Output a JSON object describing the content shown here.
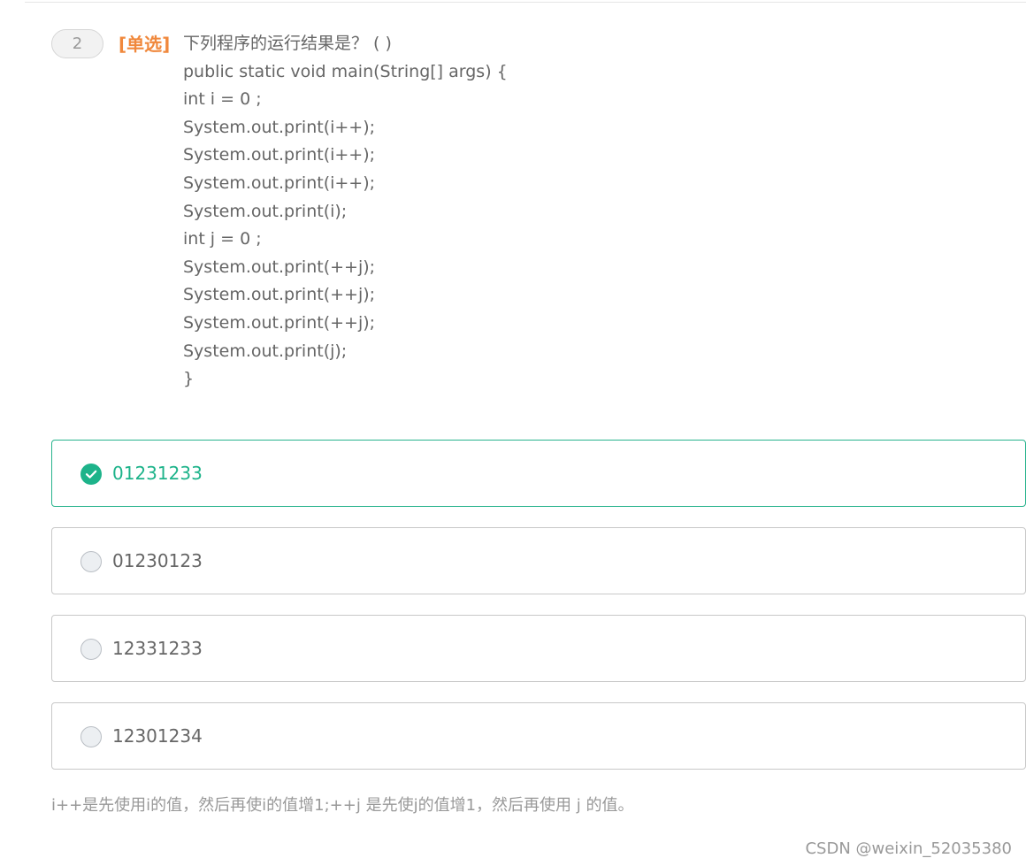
{
  "question": {
    "number": "2",
    "type_label": "[单选]",
    "lines": [
      "下列程序的运行结果是？ ( )",
      "public static void main(String[] args) {",
      "int i = 0 ;",
      "System.out.print(i++);",
      "System.out.print(i++);",
      "System.out.print(i++);",
      "System.out.print(i);",
      "int j = 0 ;",
      "System.out.print(++j);",
      "System.out.print(++j);",
      "System.out.print(++j);",
      "System.out.print(j);",
      "}"
    ]
  },
  "options": [
    {
      "text": "01231233",
      "selected": true
    },
    {
      "text": "01230123",
      "selected": false
    },
    {
      "text": "12331233",
      "selected": false
    },
    {
      "text": "12301234",
      "selected": false
    }
  ],
  "explanation": "i++是先使用i的值，然后再使i的值增1;++j 是先使j的值增1，然后再使用 j 的值。",
  "watermark": "CSDN @weixin_52035380",
  "colors": {
    "accent_green": "#1db38a",
    "type_orange": "#f0883c",
    "text_gray": "#666666"
  },
  "icons": {
    "selected_option": "check-circle-icon",
    "unselected_option": "radio-empty-icon"
  }
}
